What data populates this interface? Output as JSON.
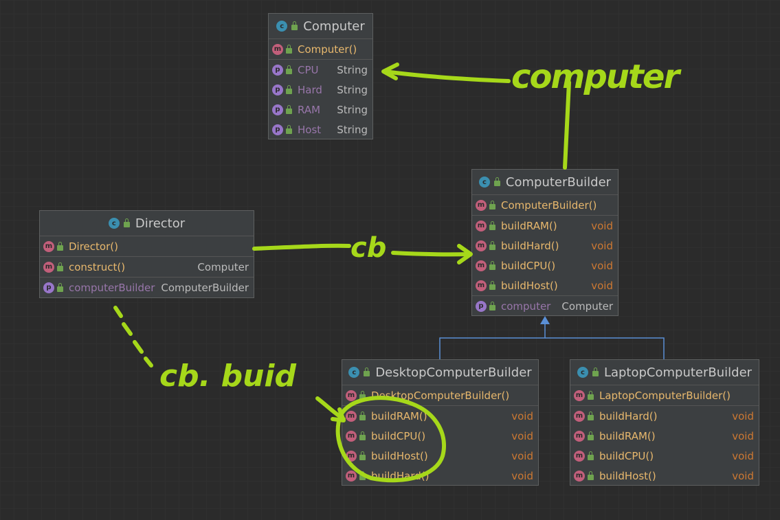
{
  "classes": {
    "computer": {
      "name": "Computer",
      "ctor": "Computer()",
      "props": [
        {
          "name": "CPU",
          "type": "String"
        },
        {
          "name": "Hard",
          "type": "String"
        },
        {
          "name": "RAM",
          "type": "String"
        },
        {
          "name": "Host",
          "type": "String"
        }
      ]
    },
    "computer_builder": {
      "name": "ComputerBuilder",
      "ctor": "ComputerBuilder()",
      "methods": [
        {
          "name": "buildRAM()",
          "type": "void"
        },
        {
          "name": "buildHard()",
          "type": "void"
        },
        {
          "name": "buildCPU()",
          "type": "void"
        },
        {
          "name": "buildHost()",
          "type": "void"
        }
      ],
      "prop": {
        "name": "computer",
        "type": "Computer"
      }
    },
    "director": {
      "name": "Director",
      "ctor": "Director()",
      "method": {
        "name": "construct()",
        "type": "Computer"
      },
      "prop": {
        "name": "computerBuilder",
        "type": "ComputerBuilder"
      }
    },
    "desktop": {
      "name": "DesktopComputerBuilder",
      "ctor": "DesktopComputerBuilder()",
      "methods": [
        {
          "name": "buildRAM()",
          "type": "void"
        },
        {
          "name": "buildCPU()",
          "type": "void"
        },
        {
          "name": "buildHost()",
          "type": "void"
        },
        {
          "name": "buildHard()",
          "type": "void"
        }
      ]
    },
    "laptop": {
      "name": "LaptopComputerBuilder",
      "ctor": "LaptopComputerBuilder()",
      "methods": [
        {
          "name": "buildHard()",
          "type": "void"
        },
        {
          "name": "buildRAM()",
          "type": "void"
        },
        {
          "name": "buildCPU()",
          "type": "void"
        },
        {
          "name": "buildHost()",
          "type": "void"
        }
      ]
    }
  },
  "badges": {
    "class": "c",
    "method": "m",
    "property": "p"
  },
  "annotations": {
    "computer_label": "computer",
    "cb_label": "cb",
    "cb_build_label": "cb. buid"
  },
  "colors": {
    "annotation": "#a6d81a",
    "inheritance": "#5a8fd6",
    "method_name": "#e8b86d",
    "property_name": "#9876aa",
    "void_type": "#cc7832"
  }
}
